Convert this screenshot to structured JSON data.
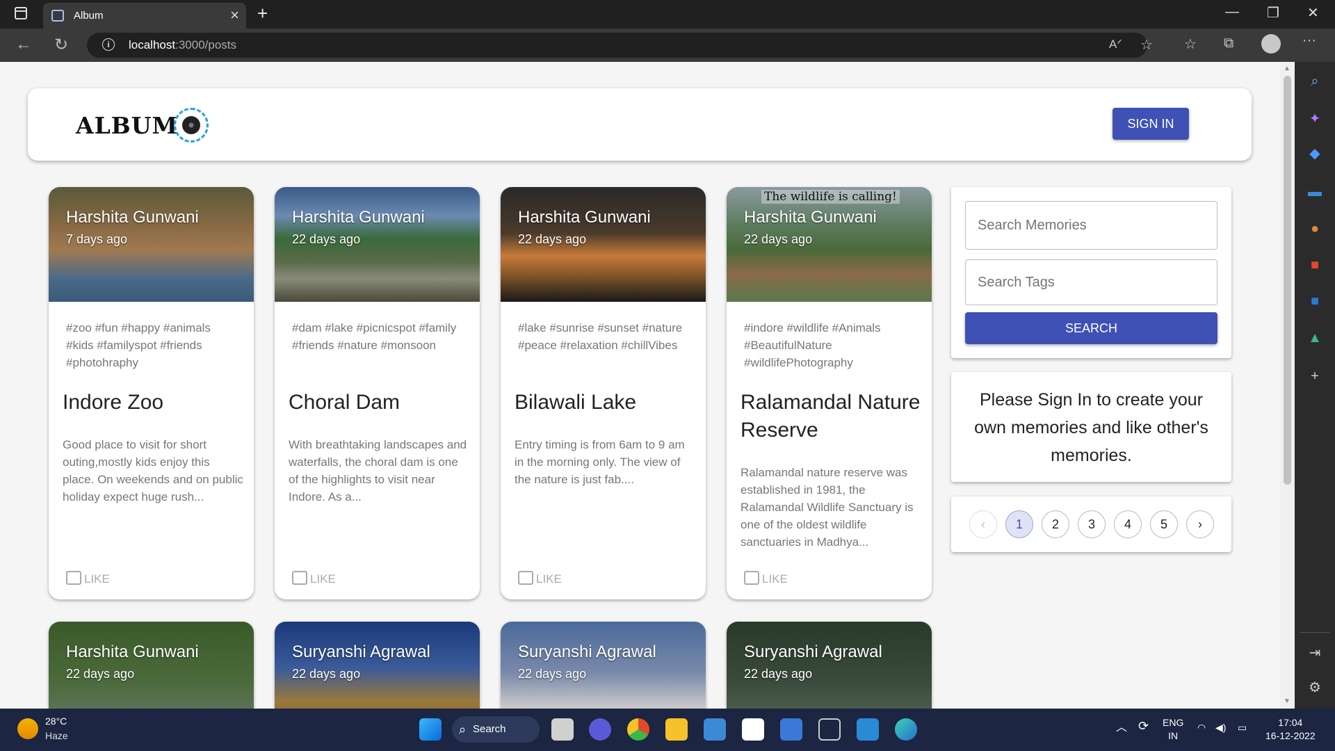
{
  "browser": {
    "tab_title": "Album",
    "url_host": "localhost",
    "url_path": ":3000/posts"
  },
  "header": {
    "logo_text": "ALBUM",
    "signin_label": "SIGN IN"
  },
  "cards": [
    {
      "author": "Harshita Gunwani",
      "time": "7 days ago",
      "tags": "#zoo #fun #happy #animals #kids #familyspot #friends #photohraphy",
      "title": "Indore Zoo",
      "message": "Good place to visit for short outing,mostly kids enjoy this place. On weekends and on public holiday expect huge rush...",
      "like": "LIKE",
      "overlay": ""
    },
    {
      "author": "Harshita Gunwani",
      "time": "22 days ago",
      "tags": "#dam #lake #picnicspot #family #friends #nature #monsoon",
      "title": "Choral Dam",
      "message": "With breathtaking landscapes and waterfalls, the choral dam is one of the highlights to visit near Indore. As a...",
      "like": "LIKE",
      "overlay": ""
    },
    {
      "author": "Harshita Gunwani",
      "time": "22 days ago",
      "tags": "#lake #sunrise #sunset #nature #peace #relaxation #chillVibes",
      "title": "Bilawali Lake",
      "message": "Entry timing is from 6am to 9 am in the morning only. The view of the nature is just fab....",
      "like": "LIKE",
      "overlay": ""
    },
    {
      "author": "Harshita Gunwani",
      "time": "22 days ago",
      "tags": "#indore #wildlife #Animals #BeautifulNature #wildlifePhotography",
      "title": "Ralamandal Nature Reserve",
      "message": "Ralamandal nature reserve was established in 1981, the Ralamandal Wildlife Sanctuary is one of the oldest wildlife sanctuaries in Madhya...",
      "like": "LIKE",
      "overlay": "The wildlife is calling!"
    },
    {
      "author": "Harshita Gunwani",
      "time": "22 days ago"
    },
    {
      "author": "Suryanshi Agrawal",
      "time": "22 days ago"
    },
    {
      "author": "Suryanshi Agrawal",
      "time": "22 days ago"
    },
    {
      "author": "Suryanshi Agrawal",
      "time": "22 days ago"
    }
  ],
  "search": {
    "memories_placeholder": "Search Memories",
    "tags_placeholder": "Search Tags",
    "button_label": "SEARCH"
  },
  "signin_notice": "Please Sign In to create your own memories and like other's memories.",
  "pagination": {
    "prev": "‹",
    "next": "›",
    "pages": [
      "1",
      "2",
      "3",
      "4",
      "5"
    ],
    "current": "1"
  },
  "taskbar": {
    "temperature": "28°C",
    "condition": "Haze",
    "search_label": "Search",
    "language": "ENG",
    "region": "IN",
    "time": "17:04",
    "date": "16-12-2022"
  },
  "colors": {
    "primary": "#3f51b5",
    "accent": "#29a3d6"
  }
}
